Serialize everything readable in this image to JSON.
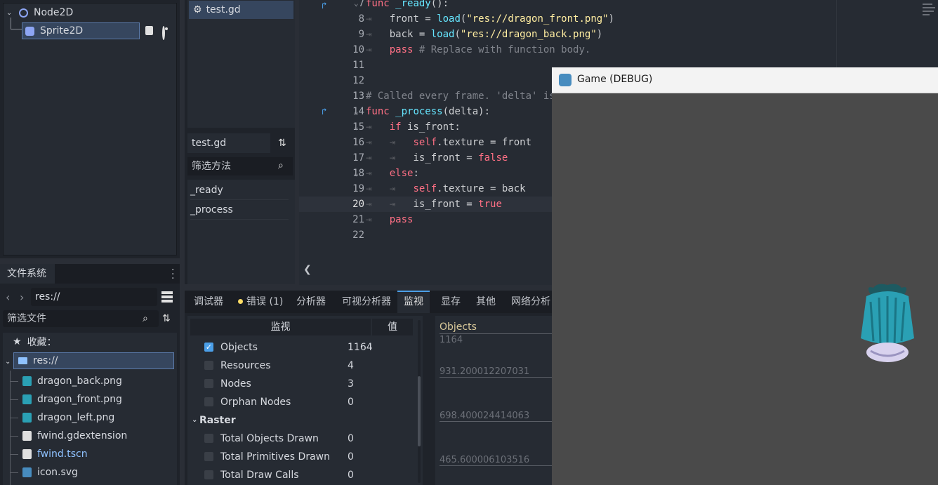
{
  "scene_tree": {
    "root": {
      "name": "Node2D"
    },
    "child": {
      "name": "Sprite2D"
    }
  },
  "filesystem": {
    "tab_label": "文件系统",
    "path_value": "res://",
    "filter_placeholder": "筛选文件",
    "favorites_label": "收藏：",
    "root_label": "res://",
    "items": [
      {
        "name": "dragon_back.png",
        "icon": "image-icon",
        "color": "#d6d9df"
      },
      {
        "name": "dragon_front.png",
        "icon": "image-icon",
        "color": "#d6d9df"
      },
      {
        "name": "dragon_left.png",
        "icon": "image-icon",
        "color": "#d6d9df"
      },
      {
        "name": "fwind.gdextension",
        "icon": "file-icon",
        "color": "#d6d9df"
      },
      {
        "name": "fwind.tscn",
        "icon": "scene-icon",
        "color": "#8fc2ff"
      },
      {
        "name": "icon.svg",
        "icon": "godot-icon",
        "color": "#d6d9df"
      }
    ]
  },
  "script_list": {
    "scripts": [
      "test.gd"
    ],
    "current_script": "test.gd",
    "method_filter_placeholder": "筛选方法",
    "methods": [
      "_ready",
      "_process"
    ]
  },
  "editor": {
    "lines": [
      {
        "n": "7",
        "text": "func _ready():"
      },
      {
        "n": "8",
        "text": "front = load(\"res://dragon_front.png\")"
      },
      {
        "n": "9",
        "text": "back = load(\"res://dragon_back.png\")"
      },
      {
        "n": "10",
        "text": "pass # Replace with function body."
      },
      {
        "n": "11",
        "text": ""
      },
      {
        "n": "12",
        "text": ""
      },
      {
        "n": "13",
        "text": "# Called every frame. 'delta' is"
      },
      {
        "n": "14",
        "text": "func _process(delta):"
      },
      {
        "n": "15",
        "text": "if is_front:"
      },
      {
        "n": "16",
        "text": "self.texture = front"
      },
      {
        "n": "17",
        "text": "is_front = false"
      },
      {
        "n": "18",
        "text": "else:"
      },
      {
        "n": "19",
        "text": "self.texture = back"
      },
      {
        "n": "20",
        "text": "is_front = true"
      },
      {
        "n": "21",
        "text": "pass"
      },
      {
        "n": "22",
        "text": ""
      }
    ],
    "current_line": "20",
    "collapse_glyph": "❮"
  },
  "bottom_panel": {
    "tabs": [
      "调试器",
      "错误 (1)",
      "分析器",
      "可视分析器",
      "监视",
      "显存",
      "其他",
      "网络分析"
    ],
    "active_tab": "监视",
    "monitor_header": "监视",
    "value_header": "值",
    "rows": [
      {
        "label": "Objects",
        "value": "1164",
        "checked": true
      },
      {
        "label": "Resources",
        "value": "4",
        "checked": false
      },
      {
        "label": "Nodes",
        "value": "3",
        "checked": false
      },
      {
        "label": "Orphan Nodes",
        "value": "0",
        "checked": false
      }
    ],
    "group": "Raster",
    "raster_rows": [
      {
        "label": "Total Objects Drawn",
        "value": "0"
      },
      {
        "label": "Total Primitives Drawn",
        "value": "0"
      },
      {
        "label": "Total Draw Calls",
        "value": "0"
      }
    ],
    "graph": {
      "title": "Objects",
      "labels": [
        "1164",
        "931.200012207031",
        "698.400024414063",
        "465.600006103516"
      ]
    }
  },
  "game_window": {
    "title": "Game (DEBUG)",
    "background": "#4a4a4a"
  }
}
